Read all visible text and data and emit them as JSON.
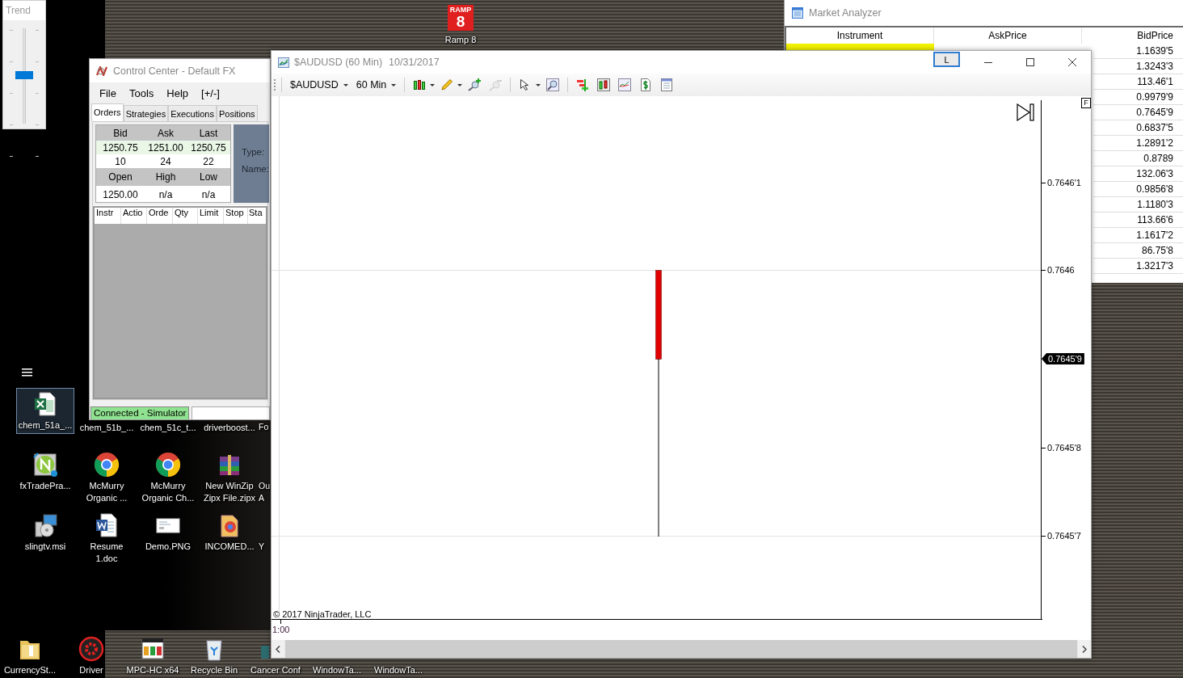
{
  "trend_window": {
    "title": "Trend",
    "level": 0.51
  },
  "ramp_shortcut": {
    "badge_top": "RAMP",
    "badge_number": "8",
    "label": "Ramp 8"
  },
  "desktop_icon_rows": [
    {
      "icons": [
        {
          "kind": "excel",
          "label": "chem_51a_...",
          "selected": true
        },
        {
          "kind": "covered",
          "label": "chem_51b_...",
          "selected": false
        },
        {
          "kind": "covered",
          "label": "chem_51c_t...",
          "selected": false
        },
        {
          "kind": "covered",
          "label": "driverboost...",
          "selected": false
        },
        {
          "kind": "partial",
          "label": "Fo",
          "selected": false
        }
      ]
    },
    {
      "icons": [
        {
          "kind": "fxtrade",
          "label": "fxTradePra...",
          "selected": false
        },
        {
          "kind": "chrome",
          "label": "McMurry Organic ...",
          "selected": false
        },
        {
          "kind": "chrome",
          "label": "McMurry Organic Ch...",
          "selected": false
        },
        {
          "kind": "winzip",
          "label": "New WinZip Zipx File.zipx",
          "selected": false
        },
        {
          "kind": "partial",
          "label": "Ou A",
          "selected": false
        }
      ]
    },
    {
      "icons": [
        {
          "kind": "installer",
          "label": "slingtv.msi",
          "selected": false
        },
        {
          "kind": "word",
          "label": "Resume 1.doc",
          "selected": false
        },
        {
          "kind": "image",
          "label": "Demo.PNG",
          "selected": false
        },
        {
          "kind": "pdfdoc",
          "label": "INCOMED...",
          "selected": false
        },
        {
          "kind": "partial",
          "label": "Y",
          "selected": false
        }
      ]
    }
  ],
  "bottom_icons": [
    {
      "kind": "folder",
      "label": "CurrencySt...",
      "selected": false
    },
    {
      "kind": "driverbooster",
      "label": "Driver",
      "selected": false
    },
    {
      "kind": "mpc",
      "label": "MPC-HC x64",
      "selected": false
    },
    {
      "kind": "recycle",
      "label": "Recycle Bin",
      "selected": false
    },
    {
      "kind": "teal",
      "label": "Cancer Conf",
      "selected": false
    },
    {
      "kind": "covered",
      "label": "WindowTa...",
      "selected": false
    },
    {
      "kind": "covered",
      "label": "WindowTa...",
      "selected": false
    }
  ],
  "control_center": {
    "title": "Control Center - Default FX",
    "menu": [
      "File",
      "Tools",
      "Help",
      "[+/-]"
    ],
    "tabs": [
      {
        "label": "Orders",
        "selected": true
      },
      {
        "label": "Strategies",
        "selected": false
      },
      {
        "label": "Executions",
        "selected": false
      },
      {
        "label": "Positions",
        "selected": false
      }
    ],
    "quote": {
      "header": [
        "Bid",
        "Ask",
        "Last"
      ],
      "prices": [
        "1250.75",
        "1251.00",
        "1250.75"
      ],
      "sizes": [
        "10",
        "24",
        "22"
      ],
      "header_2": [
        "Open",
        "High",
        "Low"
      ],
      "daily": [
        "1250.00",
        "n/a",
        "n/a"
      ]
    },
    "order_fields": [
      "Type:",
      "Name:"
    ],
    "orders_columns": [
      "Instr",
      "Actio",
      "Orde",
      "Qty",
      "Limit",
      "Stop",
      "Sta"
    ],
    "status": {
      "label": "Connected - Simulator",
      "connected": true
    }
  },
  "market_analyzer": {
    "title": "Market Analyzer",
    "columns": [
      "Instrument",
      "AskPrice",
      "BidPrice"
    ],
    "first_row_highlighted": true,
    "rows": [
      {
        "bid_price": "1.1639'5"
      },
      {
        "bid_price": "1.3243'3"
      },
      {
        "bid_price": "113.46'1"
      },
      {
        "bid_price": "0.9979'9"
      },
      {
        "bid_price": "0.7645'9"
      },
      {
        "bid_price": "0.6837'5"
      },
      {
        "bid_price": "1.2891'2"
      },
      {
        "bid_price": "0.8789"
      },
      {
        "bid_price": "132.06'3"
      },
      {
        "bid_price": "0.9856'8"
      },
      {
        "bid_price": "1.1180'3"
      },
      {
        "bid_price": "113.66'6"
      },
      {
        "bid_price": "1.1617'2"
      },
      {
        "bid_price": "86.75'8"
      },
      {
        "bid_price": "1.3217'3"
      }
    ]
  },
  "chart_window": {
    "title": "$AUDUSD (60 Min)",
    "date": "10/31/2017",
    "layout_button": "L",
    "toolbar": [
      {
        "kind": "dropdown",
        "label": "$AUDUSD"
      },
      {
        "kind": "dropdown",
        "label": "60 Min"
      },
      {
        "kind": "separator"
      },
      {
        "kind": "candles",
        "caret": true,
        "disabled": false
      },
      {
        "kind": "pencil",
        "caret": true,
        "disabled": false
      },
      {
        "kind": "zoomin",
        "caret": false,
        "disabled": false
      },
      {
        "kind": "zoomout",
        "caret": false,
        "disabled": true
      },
      {
        "kind": "separator"
      },
      {
        "kind": "pointer",
        "caret": true,
        "disabled": false
      },
      {
        "kind": "zoombox",
        "caret": false,
        "disabled": false
      },
      {
        "kind": "separator"
      },
      {
        "kind": "bars",
        "caret": false,
        "disabled": false
      },
      {
        "kind": "candlebox",
        "caret": false,
        "disabled": false
      },
      {
        "kind": "linechart",
        "caret": false,
        "disabled": false
      },
      {
        "kind": "dollar",
        "caret": false,
        "disabled": false
      },
      {
        "kind": "properties",
        "caret": false,
        "disabled": false
      }
    ],
    "price_axis": [
      {
        "label": "0.7646'1",
        "kind": "tick"
      },
      {
        "label": "0.7646",
        "kind": "tick"
      },
      {
        "label": "0.7645'9",
        "kind": "current"
      },
      {
        "label": "0.7645'8",
        "kind": "tick"
      },
      {
        "label": "0.7645'7",
        "kind": "tick"
      }
    ],
    "scale_button": "F",
    "copyright": "© 2017 NinjaTrader, LLC",
    "time_label": "1:00"
  }
}
